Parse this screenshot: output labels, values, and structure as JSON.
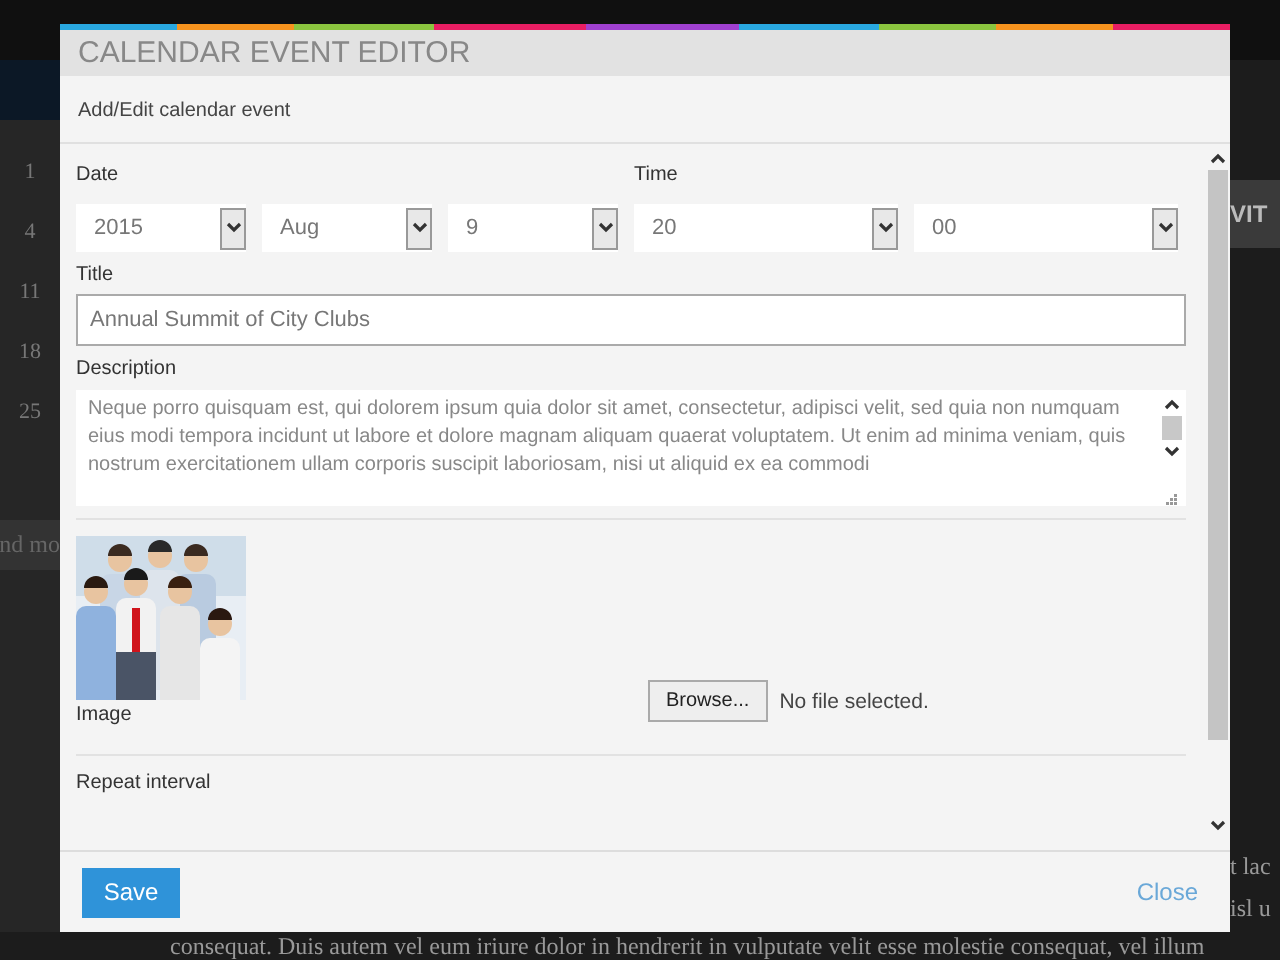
{
  "backdrop": {
    "calendar_days": [
      "1",
      "4",
      "11",
      "18",
      "25"
    ],
    "link_fragment": "nd mo",
    "heading_fragment": "VIT",
    "text_fragments": [
      "t lac",
      "isl u"
    ],
    "footer_text": "consequat. Duis autem vel eum iriure dolor in hendrerit in vulputate velit esse molestie consequat, vel illum"
  },
  "dialog": {
    "title": "CALENDAR EVENT EDITOR",
    "subtitle": "Add/Edit calendar event",
    "form": {
      "date_label": "Date",
      "date_selects": [
        {
          "value": "2015"
        },
        {
          "value": "Aug"
        },
        {
          "value": "9"
        }
      ],
      "time_label": "Time",
      "time_selects": [
        {
          "value": "20"
        },
        {
          "value": "00"
        }
      ],
      "title_label": "Title",
      "title_value": "Annual Summit of City Clubs",
      "description_label": "Description",
      "description_value": "Neque porro quisquam est, qui dolorem ipsum quia dolor sit amet, consectetur, adipisci velit, sed quia non numquam eius modi tempora incidunt ut labore et dolore magnam aliquam quaerat voluptatem. Ut enim ad minima veniam, quis nostrum exercitationem ullam corporis suscipit laboriosam, nisi ut aliquid ex ea commodi",
      "image_label": "Image",
      "browse_button": "Browse...",
      "file_status": "No file selected.",
      "repeat_label": "Repeat interval"
    },
    "buttons": {
      "save": "Save",
      "close": "Close"
    }
  }
}
